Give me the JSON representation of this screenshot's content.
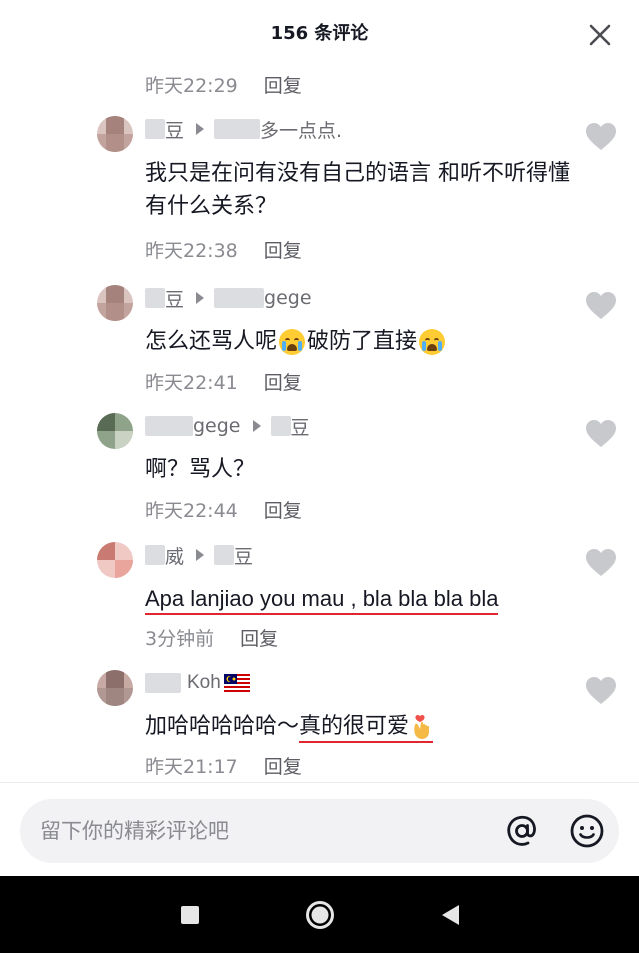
{
  "header": {
    "title": "156 条评论"
  },
  "reply_label": "回复",
  "top_meta": {
    "time": "昨天22:29"
  },
  "comments": [
    {
      "from_suffix": "豆",
      "to_suffix": "多一点点.",
      "text": "我只是在问有没有自己的语言 和听不听得懂有什么关系？",
      "time": "昨天22:38"
    },
    {
      "from_suffix": "豆",
      "to_suffix": "gege",
      "text_parts": [
        "怎么还骂人呢",
        "破防了直接"
      ],
      "emoji": "loudly-crying-face",
      "time": "昨天22:41"
    },
    {
      "from_suffix": "gege",
      "to_suffix": "豆",
      "text": "啊？骂人？",
      "time": "昨天22:44"
    },
    {
      "from_suffix": "威",
      "to_suffix": "豆",
      "text": "Apa lanjiao you mau , bla bla bla bla",
      "time": "3分钟前"
    },
    {
      "from_suffix": "Koh",
      "flag": "malaysia-flag",
      "text_plain": "加哈哈哈哈哈～",
      "text_underlined": "真的很可爱",
      "emoji": "finger-heart-hand",
      "time": "昨天21:17"
    }
  ],
  "footer": {
    "placeholder": "留下你的精彩评论吧"
  },
  "icons": {
    "close": "close-icon",
    "like": "heart-icon",
    "at": "at-sign-icon",
    "emoji": "smiley-icon",
    "nav_recent": "square-icon",
    "nav_home": "circle-icon",
    "nav_back": "triangle-back-icon"
  },
  "colors": {
    "underline": "#e0262f",
    "heart": "#c8c9cc",
    "text": "#161823",
    "meta": "#8a8b91"
  }
}
